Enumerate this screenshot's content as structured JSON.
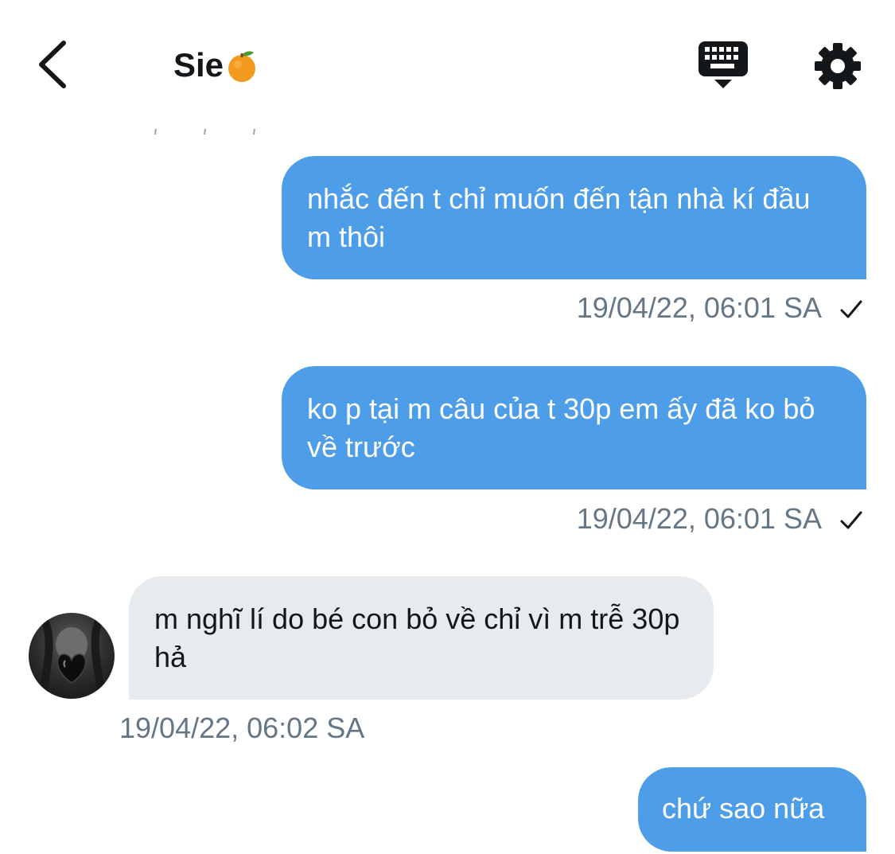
{
  "header": {
    "title": "Sie",
    "title_emoji": "orange-fruit-emoji",
    "back_icon": "chevron-left-icon",
    "keyboard_icon": "keyboard-hide-icon",
    "settings_icon": "gear-icon"
  },
  "colors": {
    "outgoing_bubble": "#4e9de8",
    "incoming_bubble": "#e7ebee",
    "timestamp": "#657786"
  },
  "messages": [
    {
      "direction": "outgoing",
      "text": "nhắc đến t chỉ muốn đến tận nhà kí đầu m thôi",
      "timestamp": "19/04/22, 06:01 SA",
      "status_icon": "check-icon"
    },
    {
      "direction": "outgoing",
      "text": "ko p tại m câu của t 30p em ấy đã ko bỏ về trước",
      "timestamp": "19/04/22, 06:01 SA",
      "status_icon": "check-icon"
    },
    {
      "direction": "incoming",
      "text": "m nghĩ lí do bé con bỏ về chỉ vì m trễ 30p hả",
      "timestamp": "19/04/22, 06:02 SA",
      "avatar_icon": "black-heart-avatar"
    },
    {
      "direction": "outgoing",
      "text": "chứ sao nữa"
    }
  ]
}
